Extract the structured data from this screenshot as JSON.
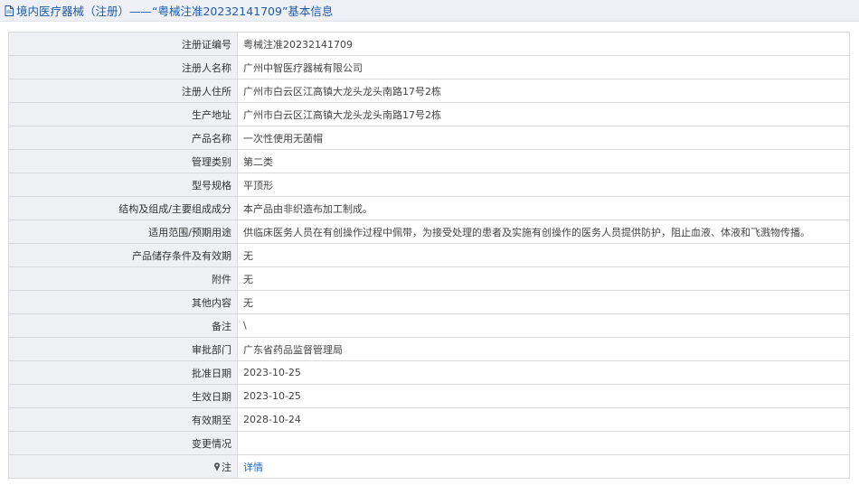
{
  "header": {
    "title": "境内医疗器械（注册）——“粤械注准20232141709”基本信息",
    "icon": "document-icon"
  },
  "rows": [
    {
      "label": "注册证编号",
      "value": "粤械注准20232141709"
    },
    {
      "label": "注册人名称",
      "value": "广州中智医疗器械有限公司"
    },
    {
      "label": "注册人住所",
      "value": "广州市白云区江高镇大龙头龙头南路17号2栋"
    },
    {
      "label": "生产地址",
      "value": "广州市白云区江高镇大龙头龙头南路17号2栋"
    },
    {
      "label": "产品名称",
      "value": "一次性使用无菌帽"
    },
    {
      "label": "管理类别",
      "value": "第二类"
    },
    {
      "label": "型号规格",
      "value": "平顶形"
    },
    {
      "label": "结构及组成/主要组成成分",
      "value": "本产品由非织造布加工制成。"
    },
    {
      "label": "适用范围/预期用途",
      "value": "供临床医务人员在有创操作过程中佩带，为接受处理的患者及实施有创操作的医务人员提供防护，阻止血液、体液和飞溅物传播。"
    },
    {
      "label": "产品储存条件及有效期",
      "value": "无"
    },
    {
      "label": "附件",
      "value": "无"
    },
    {
      "label": "其他内容",
      "value": "无"
    },
    {
      "label": "备注",
      "value": "\\"
    },
    {
      "label": "审批部门",
      "value": "广东省药品监督管理局"
    },
    {
      "label": "批准日期",
      "value": "2023-10-25"
    },
    {
      "label": "生效日期",
      "value": "2023-10-25"
    },
    {
      "label": "有效期至",
      "value": "2028-10-24"
    },
    {
      "label": "变更情况",
      "value": ""
    }
  ],
  "note_row": {
    "label": "注",
    "icon": "pin-icon",
    "link_text": "详情"
  },
  "colors": {
    "title_text": "#1f5ca8",
    "label_bg": "#eef0f3",
    "link": "#2a6bb8",
    "border": "#d9d9d9"
  }
}
